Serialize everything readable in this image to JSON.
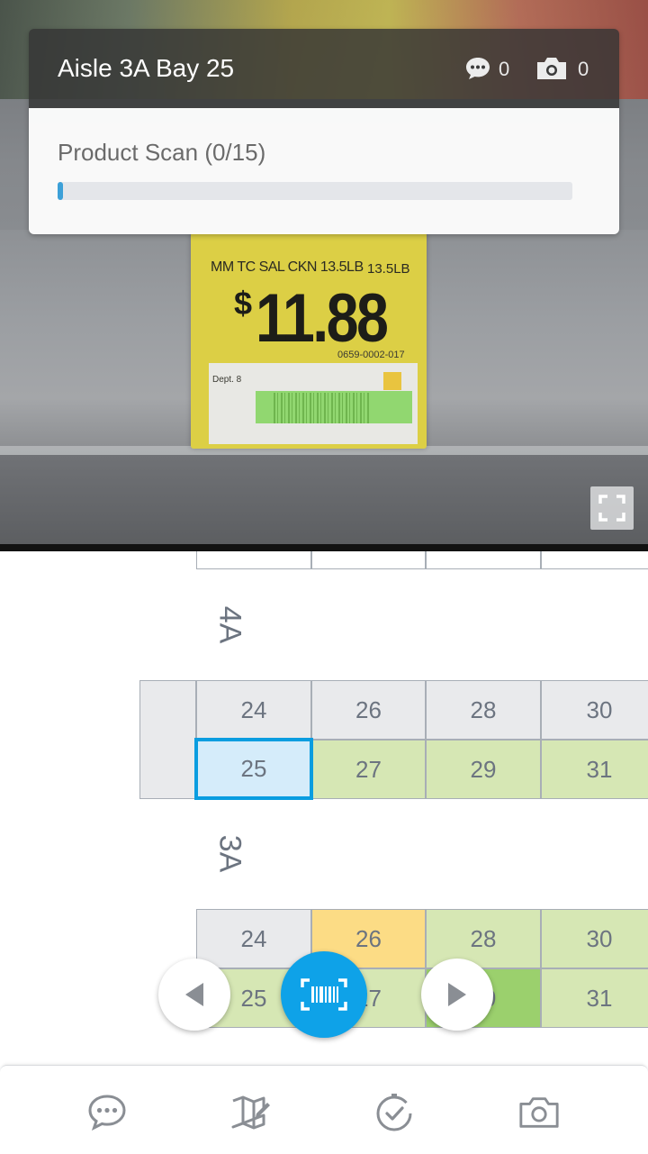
{
  "header": {
    "title": "Aisle 3A Bay 25",
    "comment_count": "0",
    "photo_count": "0"
  },
  "scan": {
    "label": "Product Scan (0/15)",
    "progress": 0.01
  },
  "camera": {
    "tag_item": "MM TC SAL CKN 13.5LB",
    "tag_weight": "13.5LB",
    "tag_price": "11.88",
    "tag_currency": "$",
    "tag_code": "0659-0002-017",
    "tag_dept": "Dept. 8"
  },
  "map": {
    "aisle_labels": [
      "4A",
      "3A"
    ],
    "sections": [
      {
        "aisle": "4A",
        "top_row": [
          "24",
          "26",
          "28",
          "30"
        ],
        "bottom_row": [
          "25",
          "27",
          "29",
          "31"
        ],
        "selected": "25"
      },
      {
        "aisle": "3A",
        "top_row": [
          "24",
          "26",
          "28",
          "30"
        ],
        "bottom_row": [
          "25",
          "27",
          "29",
          "31"
        ]
      }
    ]
  },
  "colors": {
    "accent": "#0ea2e8",
    "completed": "#d6e7b4",
    "pending": "#fcdc85",
    "selected": "#d5ecfa",
    "empty": "#e9eaec"
  },
  "icons": {
    "comment": "comment-icon",
    "camera": "camera-icon",
    "fullscreen": "fullscreen-icon",
    "prev": "triangle-left-icon",
    "next": "triangle-right-icon",
    "scan": "barcode-scan-icon",
    "map_edit": "map-edit-icon",
    "check": "check-circle-icon"
  }
}
